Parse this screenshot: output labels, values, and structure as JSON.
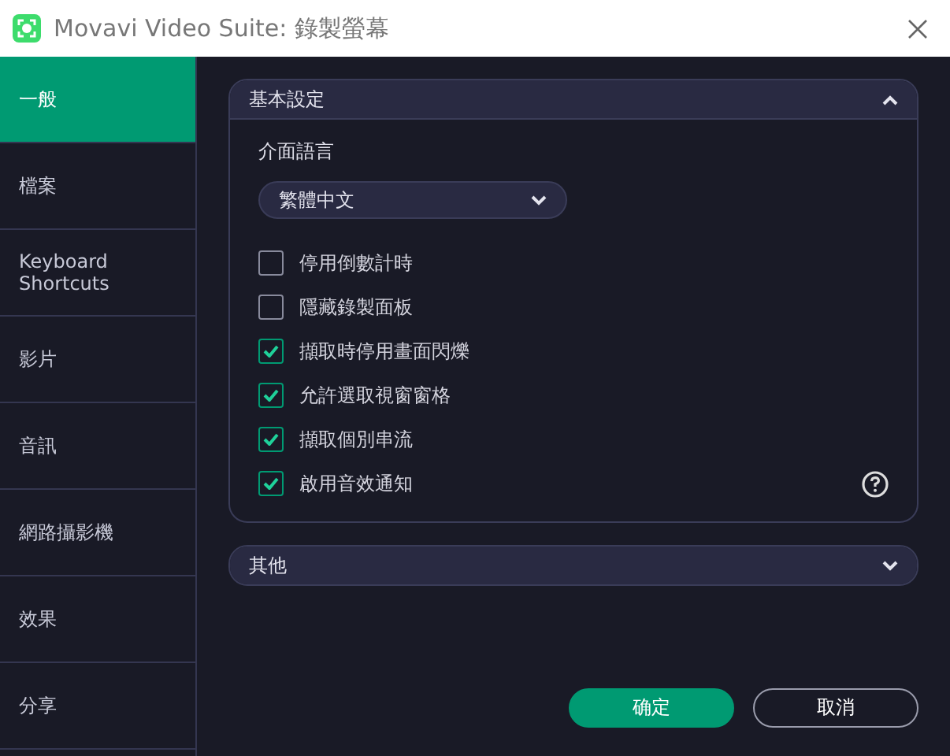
{
  "window": {
    "title": "Movavi Video Suite: 錄製螢幕"
  },
  "sidebar": {
    "items": [
      {
        "label": "一般",
        "selected": true
      },
      {
        "label": "檔案",
        "selected": false
      },
      {
        "label": "Keyboard Shortcuts",
        "selected": false
      },
      {
        "label": "影片",
        "selected": false
      },
      {
        "label": "音訊",
        "selected": false
      },
      {
        "label": "網路攝影機",
        "selected": false
      },
      {
        "label": "效果",
        "selected": false
      },
      {
        "label": "分享",
        "selected": false
      }
    ]
  },
  "sections": [
    {
      "title": "基本設定",
      "expanded": true,
      "language_label": "介面語言",
      "language": "繁體中文",
      "options": [
        {
          "label": "停用倒數計時",
          "checked": false
        },
        {
          "label": "隱藏錄製面板",
          "checked": false
        },
        {
          "label": "擷取時停用畫面閃爍",
          "checked": true
        },
        {
          "label": "允許選取視窗窗格",
          "checked": true
        },
        {
          "label": "擷取個別串流",
          "checked": true
        },
        {
          "label": "啟用音效通知",
          "checked": true
        }
      ]
    },
    {
      "title": "其他",
      "expanded": false
    }
  ],
  "buttons": [
    {
      "label": "确定",
      "kind": "primary"
    },
    {
      "label": "取消",
      "kind": "secondary"
    }
  ]
}
